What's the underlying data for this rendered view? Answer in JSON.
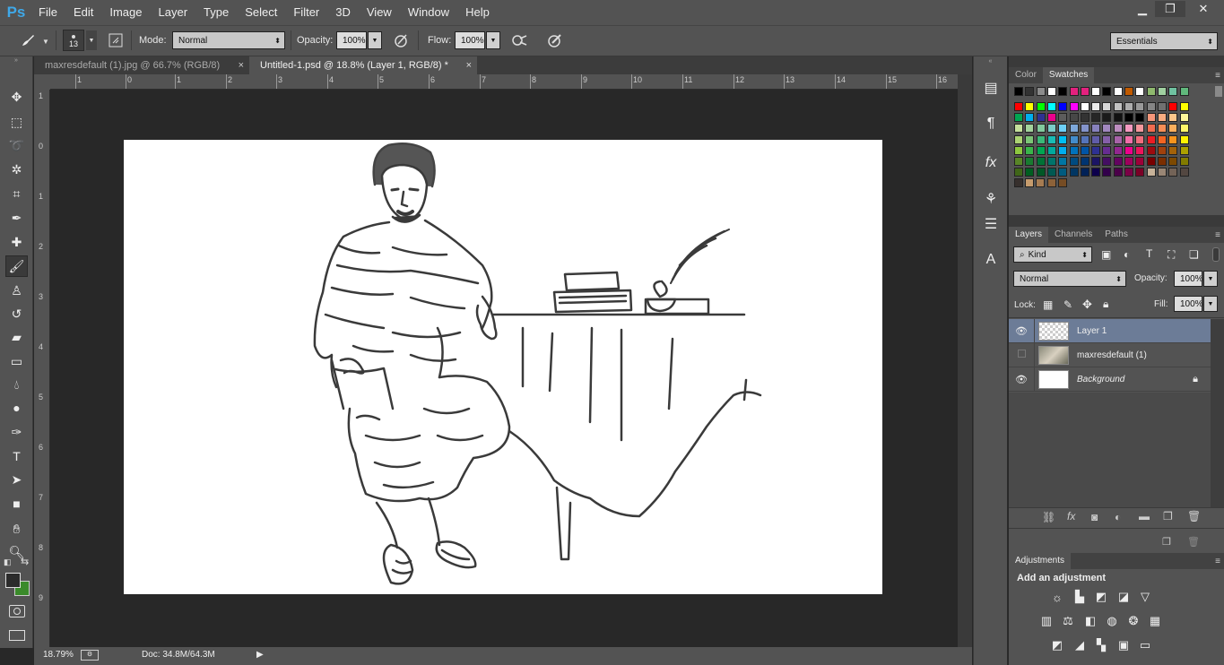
{
  "app": {
    "logo": "Ps",
    "menu": [
      "File",
      "Edit",
      "Image",
      "Layer",
      "Type",
      "Select",
      "Filter",
      "3D",
      "View",
      "Window",
      "Help"
    ],
    "window_controls": [
      "minimize-icon",
      "restore-icon",
      "close-icon"
    ]
  },
  "options": {
    "brush_size": "13",
    "mode_label": "Mode:",
    "mode_value": "Normal",
    "opacity_label": "Opacity:",
    "opacity_value": "100%",
    "flow_label": "Flow:",
    "flow_value": "100%",
    "workspace": "Essentials"
  },
  "tabs": [
    {
      "label": "maxresdefault (1).jpg @ 66.7% (RGB/8)",
      "close": "×",
      "active": false
    },
    {
      "label": "Untitled-1.psd @ 18.8% (Layer 1, RGB/8) *",
      "close": "×",
      "active": true
    }
  ],
  "rulers": {
    "h": [
      "1",
      "0",
      "1",
      "2",
      "3",
      "4",
      "5",
      "6",
      "7",
      "8",
      "9",
      "10",
      "11",
      "12",
      "13",
      "14",
      "15",
      "16"
    ],
    "v": [
      "1",
      "0",
      "1",
      "2",
      "3",
      "4",
      "5",
      "6",
      "7",
      "8",
      "9"
    ]
  },
  "status": {
    "zoom": "18.79%",
    "doc": "Doc: 34.8M/64.3M",
    "arrow": "▶"
  },
  "color_panel": {
    "tabs": [
      "Color",
      "Swatches"
    ],
    "swatch_rows": [
      [
        "#000000",
        "#333333",
        "#8c8c8c",
        "#ffffff",
        "#000000",
        "#e3217e",
        "#e3217e",
        "#ffffff",
        "#000000",
        "#ffffff",
        "#c05a00",
        "#ffffff",
        "#8fb96e",
        "#a0d0a0",
        "#6fc1a0",
        "#60b87c"
      ],
      [
        "#ff0000",
        "#ffff00",
        "#00ff00",
        "#00ffff",
        "#0000ff",
        "#ff00ff",
        "#ffffff",
        "#ebebeb",
        "#d6d6d6",
        "#c2c2c2",
        "#adadad",
        "#999999",
        "#858585",
        "#707070",
        "#ff0000",
        "#ffff00"
      ],
      [
        "#00a651",
        "#00aeef",
        "#2e3192",
        "#ec008c",
        "#5c5c5c",
        "#474747",
        "#333333",
        "#262626",
        "#1a1a1a",
        "#111111",
        "#000000",
        "#000000",
        "#f7977a",
        "#f9ad81",
        "#fdc68a",
        "#fff79a"
      ],
      [
        "#c4df9b",
        "#a3d39c",
        "#82ca9d",
        "#7accc8",
        "#6dcff6",
        "#7da7d9",
        "#8393ca",
        "#8781bd",
        "#a187be",
        "#bc8dbf",
        "#f49ac1",
        "#f5989d",
        "#f26c4f",
        "#f68e56",
        "#fbaf5d",
        "#fff568"
      ],
      [
        "#acd373",
        "#7cc576",
        "#3bb878",
        "#1abbb4",
        "#00bff3",
        "#438ccb",
        "#5574b9",
        "#605ca8",
        "#855fa8",
        "#a763a8",
        "#f06ea9",
        "#f26d7d",
        "#ed1c24",
        "#f26522",
        "#f7941d",
        "#fff200"
      ],
      [
        "#8dc73f",
        "#39b54a",
        "#00a651",
        "#00a99d",
        "#00aeef",
        "#0072bc",
        "#0054a6",
        "#2e3192",
        "#662d91",
        "#92278f",
        "#ec008c",
        "#ed145b",
        "#9e0b0f",
        "#a0410d",
        "#a36209",
        "#aba000"
      ],
      [
        "#598527",
        "#197b30",
        "#007236",
        "#00746b",
        "#0076a3",
        "#004b80",
        "#003471",
        "#1b1464",
        "#440e62",
        "#630460",
        "#9e005d",
        "#9e0039",
        "#790000",
        "#7b2e00",
        "#7d4900",
        "#827b00"
      ],
      [
        "#406618",
        "#005e20",
        "#005826",
        "#005952",
        "#005b7f",
        "#003663",
        "#002157",
        "#0d004c",
        "#32004b",
        "#4b0049",
        "#7b0046",
        "#7a0026",
        "#c7b299",
        "#998675",
        "#736357",
        "#534741"
      ]
    ],
    "last_row_extra": [
      "#37302d",
      "#c69c6d",
      "#a67c52",
      "#8c6239",
      "#754c24"
    ]
  },
  "layers_panel": {
    "tabs": [
      "Layers",
      "Channels",
      "Paths"
    ],
    "filter": "Kind",
    "blend_mode": "Normal",
    "opacity_label": "Opacity:",
    "opacity_value": "100%",
    "lock_label": "Lock:",
    "fill_label": "Fill:",
    "fill_value": "100%",
    "layers": [
      {
        "name": "Layer 1",
        "visible": true,
        "selected": true,
        "locked": false,
        "italic": false
      },
      {
        "name": "maxresdefault (1)",
        "visible": false,
        "selected": false,
        "locked": false,
        "italic": false
      },
      {
        "name": "Background",
        "visible": true,
        "selected": false,
        "locked": true,
        "italic": true
      }
    ]
  },
  "adjustments_panel": {
    "title": "Adjustments",
    "subtitle": "Add an adjustment"
  },
  "colors": {
    "foreground": "#2b2b2b",
    "background": "#3a8a2a",
    "accent_blue": "#3fa8e8",
    "selected_layer": "#6c7c97"
  }
}
